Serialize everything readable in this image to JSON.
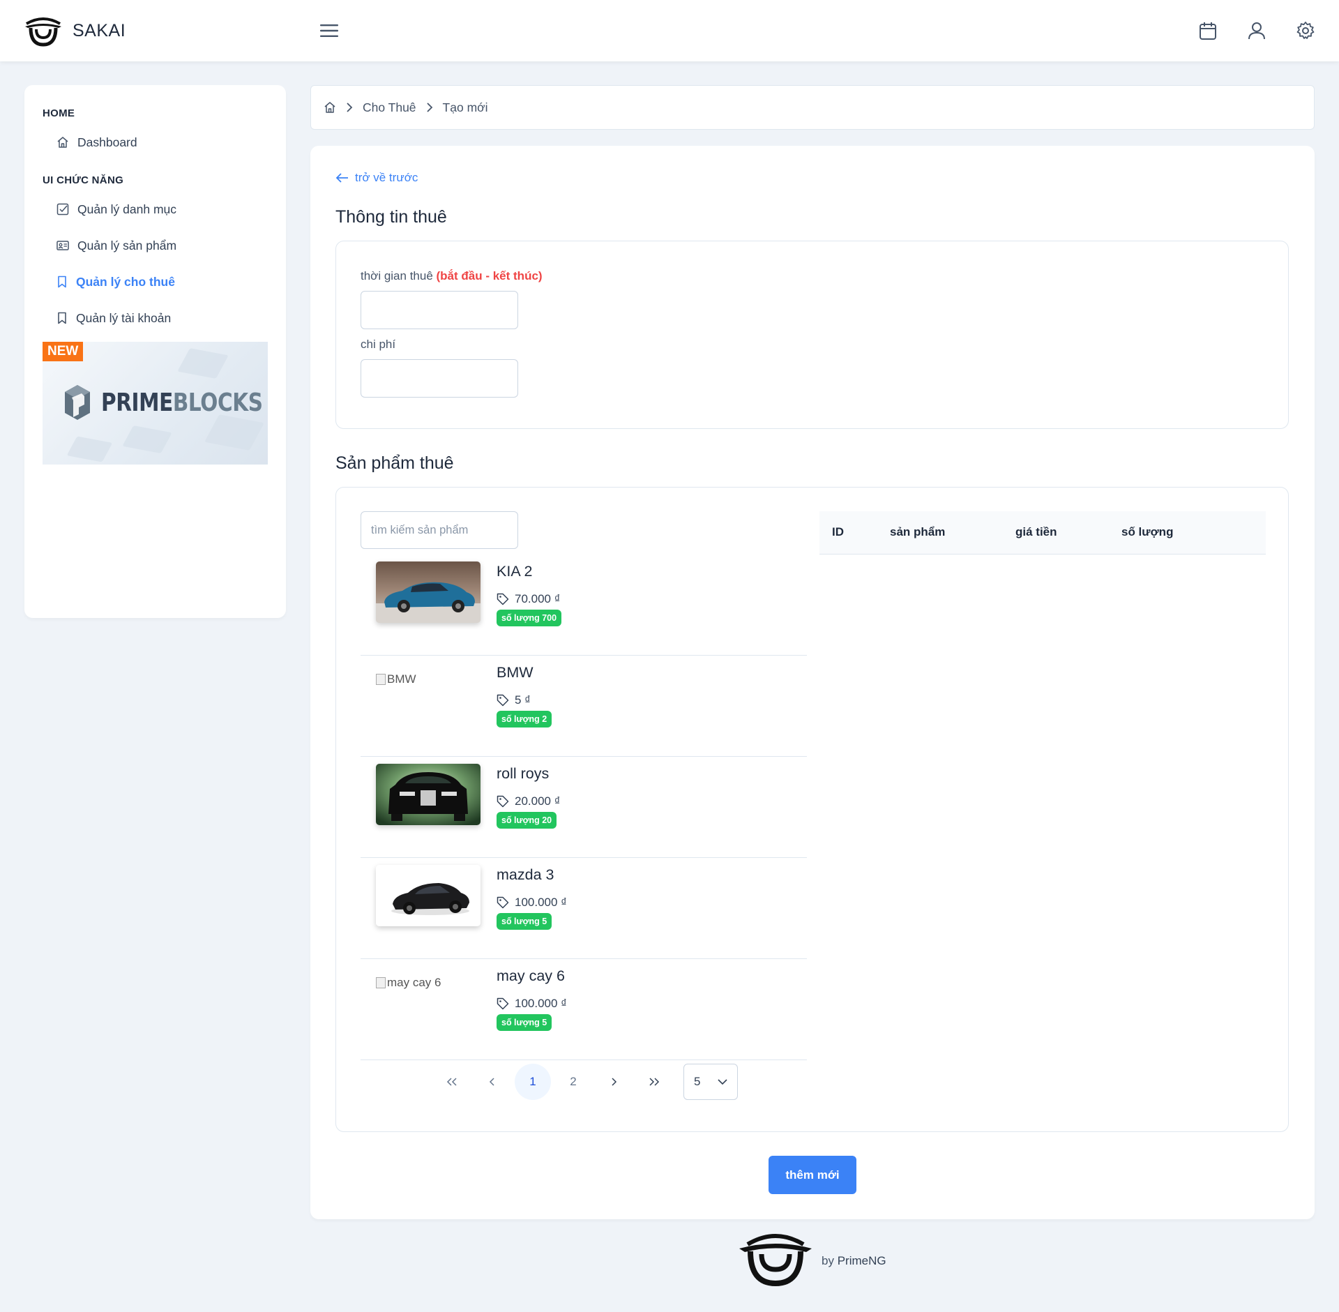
{
  "topbar": {
    "app_name": "SAKAI",
    "icons": [
      "menu-icon",
      "calendar-icon",
      "user-icon",
      "cog-icon"
    ]
  },
  "sidebar": {
    "sections": [
      {
        "title": "HOME",
        "items": [
          {
            "label": "Dashboard",
            "icon": "home-icon",
            "active": false
          }
        ]
      },
      {
        "title": "UI CHỨC NĂNG",
        "items": [
          {
            "label": "Quản lý danh mục",
            "icon": "check-square-icon",
            "active": false
          },
          {
            "label": "Quản lý sản phẩm",
            "icon": "id-card-icon",
            "active": false
          },
          {
            "label": "Quản lý cho thuê",
            "icon": "bookmark-icon",
            "active": true
          },
          {
            "label": "Quản lý tài khoản",
            "icon": "bookmark-icon",
            "active": false
          }
        ]
      }
    ],
    "promo": {
      "badge": "NEW",
      "brand_a": "PRIME",
      "brand_b": "BLOCKS"
    }
  },
  "breadcrumb": {
    "home_icon": "home-icon",
    "items": [
      "Cho Thuê",
      "Tạo mới"
    ]
  },
  "main": {
    "back_label": "trở về trước",
    "rental_info_title": "Thông tin thuê",
    "period_label": "thời gian thuê",
    "period_hint": "(bắt đầu - kết thúc)",
    "period_value": "",
    "cost_label": "chi phí",
    "cost_value": "",
    "products_title": "Sản phẩm thuê",
    "search_placeholder": "tìm kiếm sản phẩm",
    "products": [
      {
        "name": "KIA 2",
        "price": "70.000 ₫",
        "qty": "số lượng 700",
        "image": "blue-sedan",
        "alt": ""
      },
      {
        "name": "BMW",
        "price": "5 ₫",
        "qty": "số lượng 2",
        "image": "broken",
        "alt": "BMW"
      },
      {
        "name": "roll roys",
        "price": "20.000 ₫",
        "qty": "số lượng 20",
        "image": "black-rolls",
        "alt": ""
      },
      {
        "name": "mazda 3",
        "price": "100.000 ₫",
        "qty": "số lượng 5",
        "image": "black-sedan",
        "alt": ""
      },
      {
        "name": "may cay 6",
        "price": "100.000 ₫",
        "qty": "số lượng 5",
        "image": "broken",
        "alt": "may cay 6"
      }
    ],
    "paginator": {
      "pages": [
        "1",
        "2"
      ],
      "current": "1",
      "rows_per_page": "5"
    },
    "table_headers": {
      "id": "ID",
      "product": "sản phẩm",
      "price": "giá tiền",
      "quantity": "số lượng"
    },
    "add_button": "thêm mới"
  },
  "footer": {
    "by": "by",
    "brand": "PrimeNG"
  },
  "colors": {
    "primary": "#3b82f6",
    "success": "#22c55e",
    "danger": "#ef4444",
    "badge_orange": "#f97316",
    "background": "#eff3f8"
  }
}
